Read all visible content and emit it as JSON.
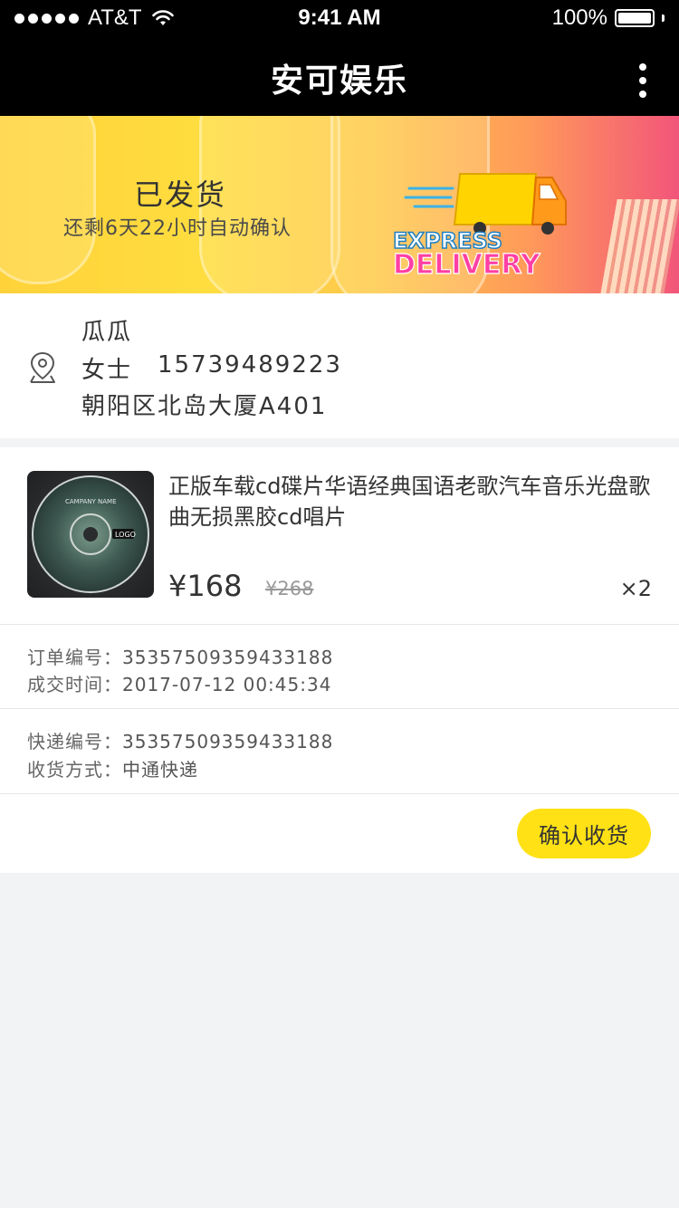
{
  "status_bar": {
    "carrier": "AT&T",
    "time": "9:41 AM",
    "battery": "100%"
  },
  "nav": {
    "title": "安可娱乐"
  },
  "banner": {
    "status": "已发货",
    "subtitle": "还剩6天22小时自动确认",
    "logo_text_top": "EXPRESS",
    "logo_text_bottom": "DELIVERY"
  },
  "address": {
    "name": "瓜瓜",
    "title": "女士",
    "phone": "15739489223",
    "line": "朝阳区北岛大厦A401"
  },
  "product": {
    "title": "正版车载cd碟片华语经典国语老歌汽车音乐光盘歌曲无损黑胶cd唱片",
    "price": "¥168",
    "original_price": "¥268",
    "quantity": "×2",
    "thumb_label_1": "CAMPANY NAME",
    "thumb_label_2": "LOGO"
  },
  "order_info": {
    "order_no_label": "订单编号：",
    "order_no": "35357509359433188",
    "deal_time_label": "成交时间：",
    "deal_time": "2017-07-12 00:45:34"
  },
  "shipping_info": {
    "express_no_label": "快递编号：",
    "express_no": "35357509359433188",
    "method_label": "收货方式：",
    "method": "中通快递"
  },
  "actions": {
    "confirm_receipt": "确认收货"
  },
  "colors": {
    "accent": "#ffe115",
    "header": "#000000"
  }
}
